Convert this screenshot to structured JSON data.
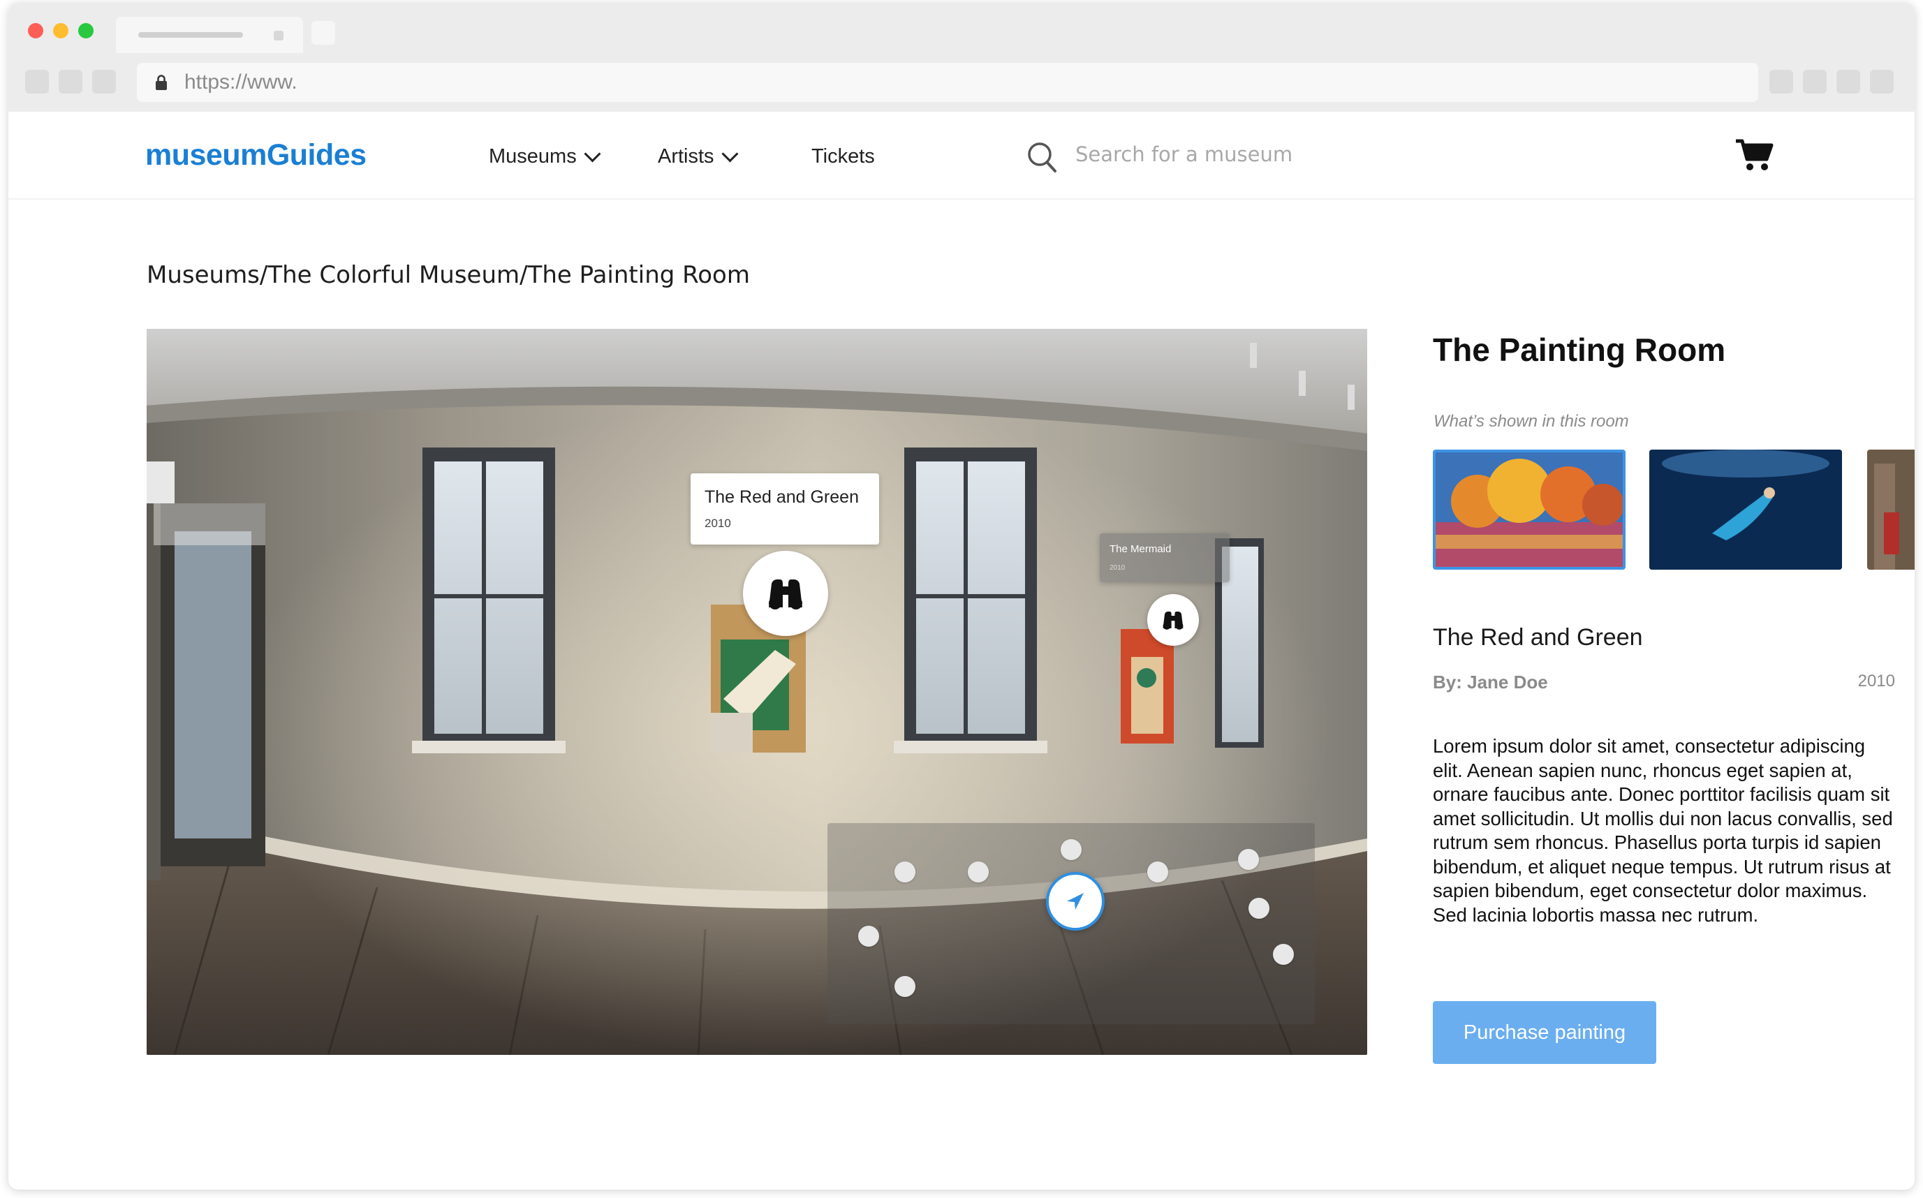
{
  "browser": {
    "url": "https://www."
  },
  "header": {
    "logo": "museumGuides",
    "nav": [
      {
        "label": "Museums"
      },
      {
        "label": "Artists"
      },
      {
        "label": "Tickets"
      }
    ],
    "search_placeholder": "Search for a museum"
  },
  "breadcrumb": "Museums/The Colorful Museum/The Painting Room",
  "viewer": {
    "hotspots": [
      {
        "title": "The Red and Green",
        "year": "2010"
      },
      {
        "title": "The Mermaid",
        "year": "2010"
      }
    ]
  },
  "panel": {
    "room_title": "The Painting Room",
    "shown_label": "What’s shown in this room",
    "painting_title": "The Red and Green",
    "artist": "By: Jane Doe",
    "year": "2010",
    "description": "Lorem ipsum dolor sit amet, consectetur adipiscing elit. Aenean sapien nunc, rhoncus eget sapien at, ornare faucibus ante. Donec porttitor facilisis quam sit amet sollicitudin. Ut mollis dui non lacus convallis, sed rutrum sem rhoncus. Phasellus porta turpis id sapien bibendum, et aliquet neque tempus. Ut rutrum risus at sapien bibendum, eget consectetur dolor maximus. Sed lacinia lobortis massa nec rutrum.",
    "purchase_label": "Purchase painting"
  },
  "colors": {
    "brand": "#1a7fd4",
    "accent": "#3d93e6",
    "button": "#6aaef0"
  },
  "icons": [
    "lock-icon",
    "chevron-down-icon",
    "search-icon",
    "cart-icon",
    "binoculars-icon",
    "location-arrow-icon"
  ]
}
